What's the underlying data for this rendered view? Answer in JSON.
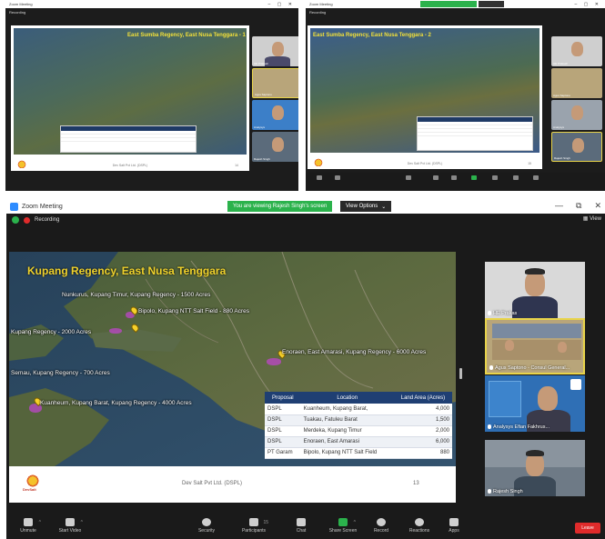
{
  "window": {
    "title": "Zoom Meeting",
    "recording": "Recording",
    "viewing_banner": "You are viewing Rajesh Singh's screen",
    "view_options": "View Options",
    "view_menu": "View",
    "minimize": "—",
    "restore": "⧉",
    "close": "✕"
  },
  "slide": {
    "title": "Kupang Regency, East Nusa Tenggara",
    "map_labels": [
      "Nunkurus, Kupang Timur, Kupang Regency - 1500 Acres",
      "Bipolo, Kupang NTT Salt Field - 880 Acres",
      "Kupang Regency - 2000 Acres",
      "Enoraen, East Amarasi, Kupang Regency - 6000 Acres",
      "Semau, Kupang Regency - 700 Acres",
      "Kuanheum, Kupang Barat, Kupang Regency - 4000 Acres"
    ],
    "table": {
      "headers": [
        "Proposal",
        "Location",
        "Land Area (Acres)"
      ],
      "rows": [
        [
          "DSPL",
          "Kuanheum, Kupang Barat,",
          "4,000"
        ],
        [
          "DSPL",
          "Tuakau, Fatuleu Barat",
          "1,500"
        ],
        [
          "DSPL",
          "Merdeka, Kupang Timur",
          "2,000"
        ],
        [
          "DSPL",
          "Enoraen, East Amarasi",
          "6,000"
        ],
        [
          "PT Garam",
          "Bipolo, Kupang NTT Salt Field",
          "880"
        ]
      ]
    },
    "footer_company": "Dev Salt Pvt Ltd. (DSPL)",
    "page_number": "13",
    "logo_text": "DevSalt"
  },
  "participants": [
    {
      "name": "HE Prakas"
    },
    {
      "name": "Agus Saptono - Consul General..."
    },
    {
      "name": "Analysys Efian Fakhrus..."
    },
    {
      "name": "Rajesh Singh"
    }
  ],
  "toolbar": {
    "unmute": "Unmute",
    "start_video": "Start Video",
    "security": "Security",
    "participants": "Participants",
    "participants_count": "15",
    "chat": "Chat",
    "share_screen": "Share Screen",
    "record": "Record",
    "reactions": "Reactions",
    "apps": "Apps",
    "leave": "Leave"
  },
  "thumb_left": {
    "title": "Zoom Meeting",
    "recording": "Recording",
    "slide_title": "East Sumba Regency, East Nusa Tenggara - 1",
    "footer": "Dev Salt Pvt Ltd. (DSPL)",
    "page": "14",
    "video_names": [
      "HE Prakash",
      "Agus Saptono",
      "Analysys",
      "Rajesh Singh"
    ]
  },
  "thumb_right": {
    "title": "Zoom Meeting",
    "recording": "Recording",
    "slide_title": "East Sumba Regency, East Nusa Tenggara - 2",
    "footer": "Dev Salt Pvt Ltd. (DSPL)",
    "page": "15",
    "video_names": [
      "HE Prakash",
      "Agus Saptono",
      "Analysys",
      "Rajesh Singh"
    ]
  }
}
